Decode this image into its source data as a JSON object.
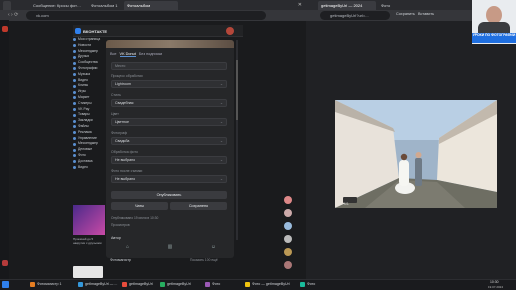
{
  "browser_left": {
    "tabs": [
      "Сообщение: Кросы фот…",
      "Фотоальбом 1",
      "Фотоальбом"
    ],
    "address": "vk.com"
  },
  "vk": {
    "logo": "ВКОНТАКТЕ",
    "sidebar": [
      "Моя страница",
      "Новости",
      "Мессенджер",
      "Друзья",
      "Сообщества",
      "Фотографии",
      "Музыка",
      "Видео",
      "Клипы",
      "Игры",
      "Маркет",
      "Стикеры",
      "VK Pay",
      "Товары",
      "Закладки",
      "Файлы",
      "Реклама",
      "Управление",
      "Мессенджер",
      "Деловые",
      "Фото",
      "Доставка",
      "Видео"
    ],
    "promo_text": "Прокачай до 5 накрутки с друзьями",
    "editor": {
      "tabs": [
        "Все",
        "VK Donut",
        "Без подписки"
      ],
      "place_placeholder": "Место",
      "fields": [
        {
          "label": "Процесс обработки",
          "value": "Lightroom"
        },
        {
          "label": "Стиль",
          "value": "Свадебная"
        },
        {
          "label": "Цвет",
          "value": "Цветное"
        },
        {
          "label": "Фотограф",
          "value": "Свадьба"
        },
        {
          "label": "Обработка фото",
          "value": "Не выбрано"
        },
        {
          "label": "Фото после съемки",
          "value": "Не выбрано"
        }
      ],
      "publish_label": "Опубликовать",
      "btn_left": "Чаты",
      "btn_right": "Сохранено",
      "meta_date": "Опубликовано 19 июля в 10:30",
      "meta_views": "Просмотров",
      "author_label": "Автор",
      "author_name": "Фотомагистр",
      "footer_link": "Показать 100 ещё"
    }
  },
  "browser_right": {
    "tabs": [
      "getimageByUrl — 2024",
      "Фото"
    ],
    "address": "getimageByUrl?url=...",
    "tabs_small": [
      "Сохранить",
      "Вставить"
    ],
    "page_counter": "1/1",
    "channel_caption": "УРОКИ ПО ФОТОГРАФИИ"
  },
  "taskbar": {
    "items": [
      "Фотомагистр 1",
      "getImageByUrl — ...",
      "getImageByUrl",
      "getImageByUrl",
      "Фото",
      "Фото — getImageByUrl",
      "Фото"
    ],
    "time": "10:30",
    "date": "19.07.2024"
  },
  "colors": {
    "vk_blue": "#5a8fd0",
    "accent": "#2f80ed"
  }
}
